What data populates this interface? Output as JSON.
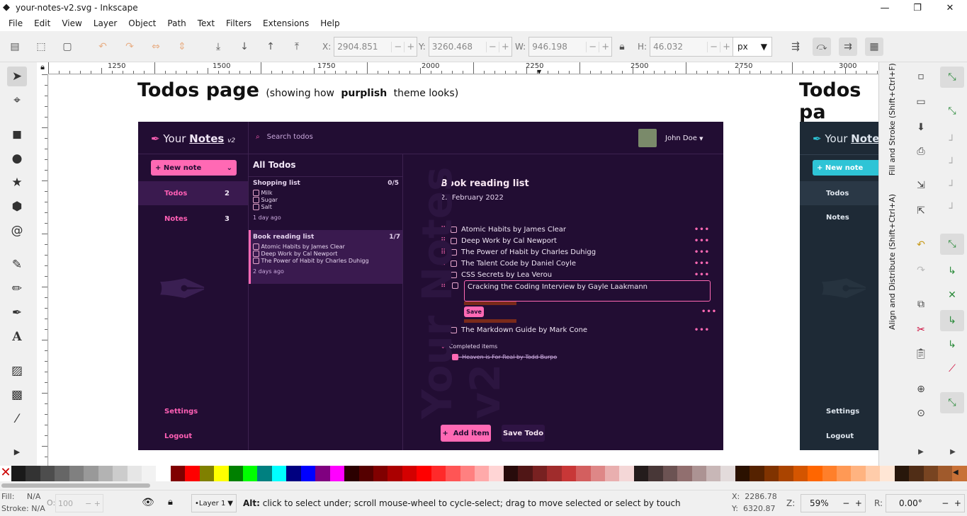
{
  "window": {
    "title": "your-notes-v2.svg - Inkscape",
    "controls": [
      "—",
      "❐",
      "✕"
    ]
  },
  "menu": [
    "File",
    "Edit",
    "View",
    "Layer",
    "Object",
    "Path",
    "Text",
    "Filters",
    "Extensions",
    "Help"
  ],
  "toolbar": {
    "x_label": "X:",
    "x": "2904.851",
    "y_label": "Y:",
    "y": "3260.468",
    "w_label": "W:",
    "w": "946.198",
    "h_label": "H:",
    "h": "46.032",
    "unit": "px",
    "minus": "−",
    "plus": "+"
  },
  "ruler": {
    "labels": [
      "1250",
      "1500",
      "1750",
      "2000",
      "2250",
      "2500",
      "2750",
      "3000"
    ]
  },
  "canvas": {
    "heading1": {
      "main": "Todos page",
      "pre": "(showing how",
      "bold": "purplish",
      "post": "theme looks)"
    },
    "heading2": "Todos pa"
  },
  "app": {
    "brand_pre": "Your",
    "brand_bold": "Notes",
    "brand_ver": "v2",
    "search_placeholder": "Search todos",
    "user": "John Doe",
    "new_note": "New note",
    "nav": [
      {
        "label": "Todos",
        "count": "2"
      },
      {
        "label": "Notes",
        "count": "3"
      }
    ],
    "settings": "Settings",
    "logout": "Logout",
    "list_title": "All Todos",
    "lists": [
      {
        "title": "Shopping list",
        "count": "0/5",
        "items": [
          "Milk",
          "Sugar",
          "Salt"
        ],
        "ago": "1 day ago"
      },
      {
        "title": "Book reading list",
        "count": "1/7",
        "items": [
          "Atomic Habits by James Clear",
          "Deep Work by Cal Newport",
          "The Power of Habit by Charles Duhigg"
        ],
        "ago": "2 days ago"
      }
    ],
    "detail": {
      "title": "Book  reading list",
      "date": "22 February 2022",
      "items": [
        "Atomic Habits by James Clear",
        "Deep Work by Cal Newport",
        "The Power of Habit by Charles Duhigg",
        "The Talent Code by Daniel Coyle",
        "CSS Secrets by Lea Verou"
      ],
      "editing_value": "Cracking the Coding Interview by Gayle Laakmann",
      "save": "Save",
      "after_item": "The Markdown Guide by Mark Cone",
      "completed_label": "Completed items",
      "completed": [
        "Heaven is For Real by Todd Burpo"
      ],
      "add_item": "Add item",
      "save_todo": "Save Todo",
      "more": "•••"
    }
  },
  "right_dock": {
    "fill_stroke_tab": "Fill and Stroke (Shift+Ctrl+F)",
    "align_tab": "Align and Distribute (Shift+Ctrl+A)"
  },
  "status": {
    "fill_label": "Fill:",
    "fill": "N/A",
    "stroke_label": "Stroke:",
    "stroke": "N/A",
    "o_label": "O:",
    "opacity": "100",
    "layer": "•Layer 1",
    "message_bold": "Alt:",
    "message": " click to select under; scroll mouse-wheel to cycle-select; drag to move selected or select by touch",
    "cx_label": "X:",
    "cx": "2286.78",
    "cy_label": "Y:",
    "cy": "6320.87",
    "z_label": "Z:",
    "zoom": "59%",
    "r_label": "R:",
    "rotation": "0.00°"
  },
  "palette": [
    "#1a1a1a",
    "#333333",
    "#4d4d4d",
    "#666666",
    "#808080",
    "#999999",
    "#b3b3b3",
    "#cccccc",
    "#e6e6e6",
    "#f2f2f2",
    "#ffffff",
    "#800000",
    "#ff0000",
    "#808000",
    "#ffff00",
    "#008000",
    "#00ff00",
    "#008080",
    "#00ffff",
    "#000080",
    "#0000ff",
    "#800080",
    "#ff00ff",
    "#2b0000",
    "#550000",
    "#800000",
    "#aa0000",
    "#d40000",
    "#ff0000",
    "#ff2a2a",
    "#ff5555",
    "#ff8080",
    "#ffaaaa",
    "#ffd5d5",
    "#280b0b",
    "#501616",
    "#782121",
    "#a02c2c",
    "#c83737",
    "#d35f5f",
    "#de8787",
    "#e9afaf",
    "#f4d7d7",
    "#241c1c",
    "#483737",
    "#6c5353",
    "#916f6f",
    "#ac9393",
    "#c8b7b7",
    "#e3dbdb",
    "#2b1100",
    "#552200",
    "#803300",
    "#aa4400",
    "#d45500",
    "#ff6600",
    "#ff7f2a",
    "#ff9955",
    "#ffb380",
    "#ffccaa",
    "#ffe6d5",
    "#28170b",
    "#502d16",
    "#784421",
    "#a05a2c",
    "#c87137"
  ]
}
